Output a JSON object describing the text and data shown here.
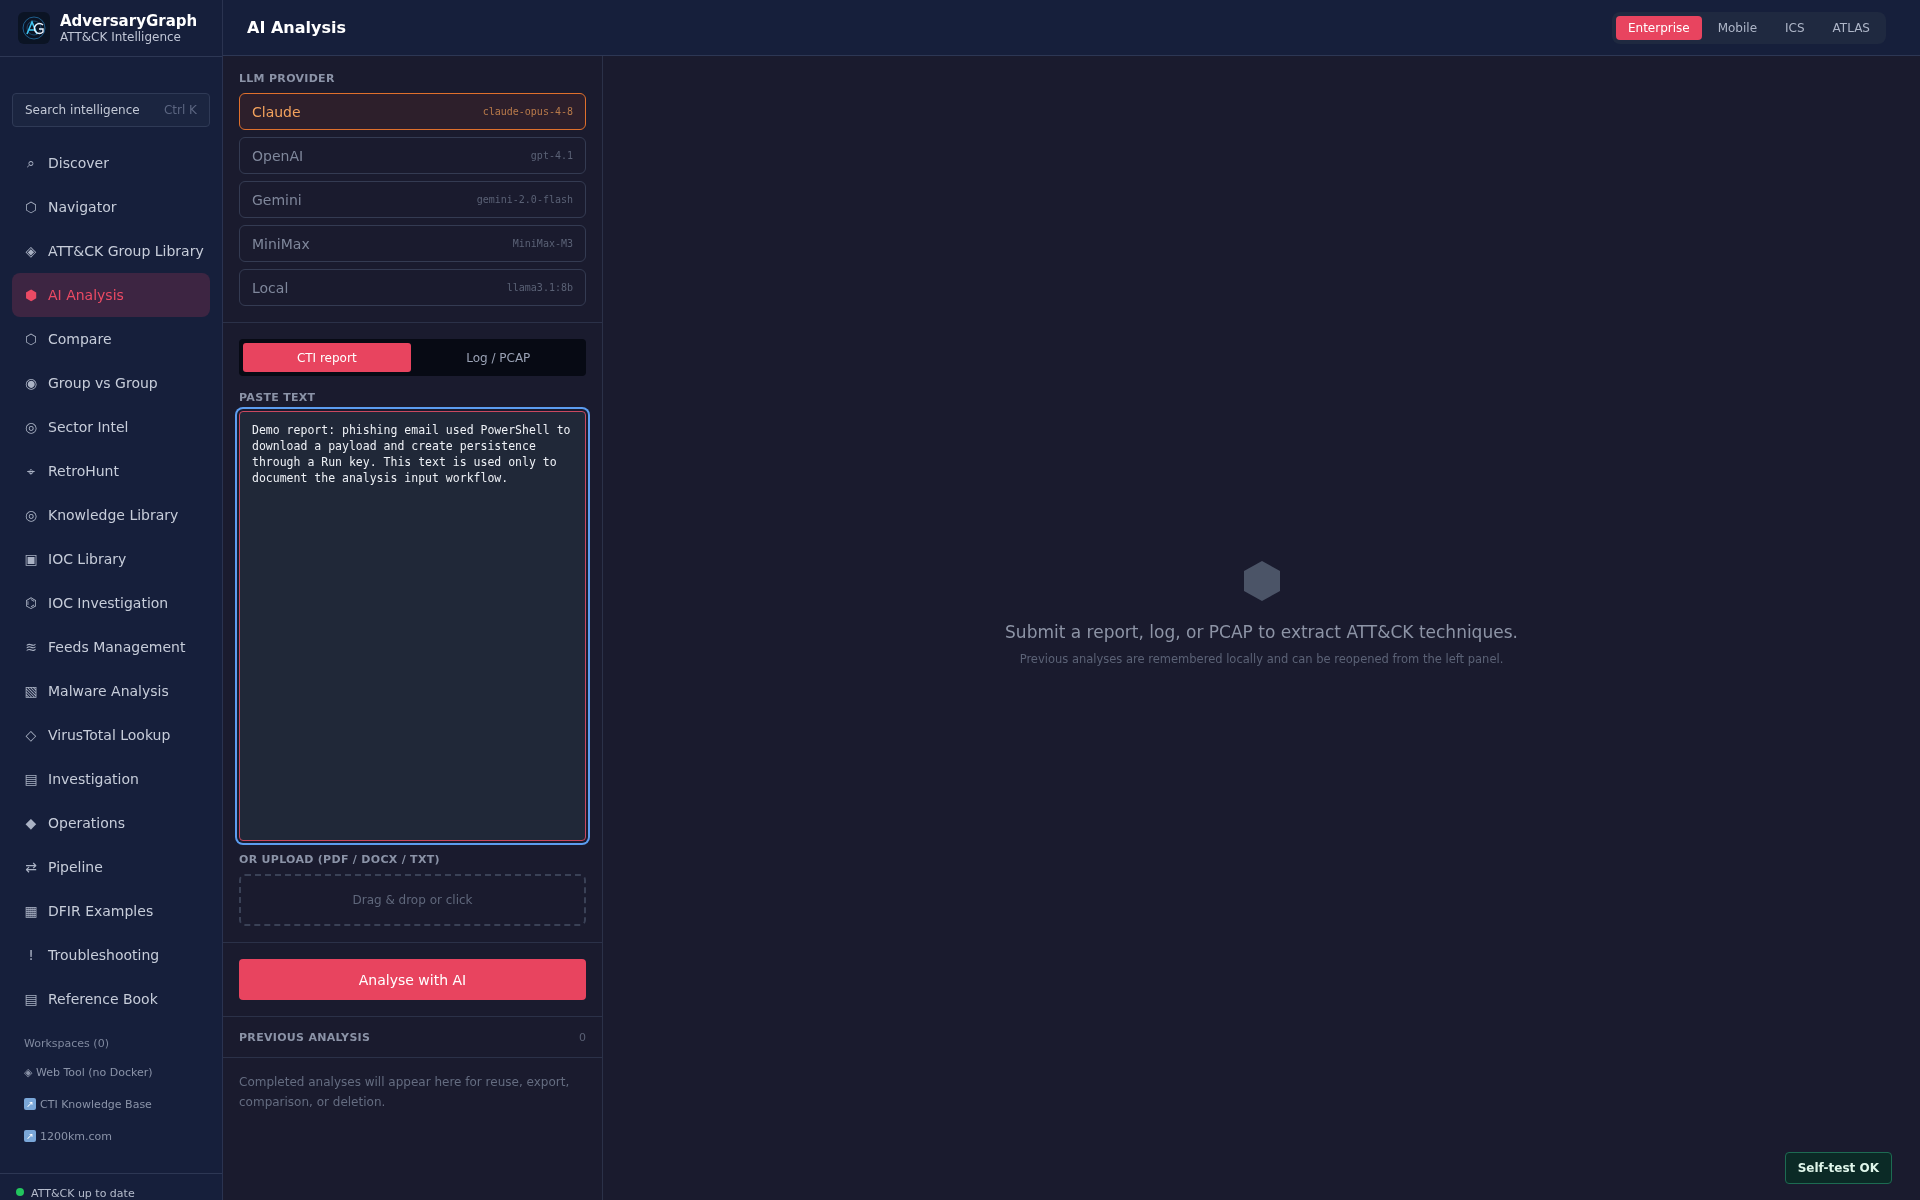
{
  "brand": {
    "name": "AdversaryGraph",
    "tagline": "ATT&CK Intelligence"
  },
  "search": {
    "placeholder": "Search intelligence",
    "shortcut": "Ctrl K"
  },
  "nav": {
    "items": [
      {
        "icon": "⌕",
        "label": "Discover",
        "selected": false
      },
      {
        "icon": "⬡",
        "label": "Navigator",
        "selected": false
      },
      {
        "icon": "◈",
        "label": "ATT&CK Group Library",
        "selected": false
      },
      {
        "icon": "⬢",
        "label": "AI Analysis",
        "selected": true
      },
      {
        "icon": "⬡",
        "label": "Compare",
        "selected": false
      },
      {
        "icon": "◉",
        "label": "Group vs Group",
        "selected": false
      },
      {
        "icon": "◎",
        "label": "Sector Intel",
        "selected": false
      },
      {
        "icon": "⌖",
        "label": "RetroHunt",
        "selected": false
      },
      {
        "icon": "◎",
        "label": "Knowledge Library",
        "selected": false
      },
      {
        "icon": "▣",
        "label": "IOC Library",
        "selected": false
      },
      {
        "icon": "⌬",
        "label": "IOC Investigation",
        "selected": false
      },
      {
        "icon": "≋",
        "label": "Feeds Management",
        "selected": false
      },
      {
        "icon": "▧",
        "label": "Malware Analysis",
        "selected": false
      },
      {
        "icon": "◇",
        "label": "VirusTotal Lookup",
        "selected": false
      },
      {
        "icon": "▤",
        "label": "Investigation",
        "selected": false
      },
      {
        "icon": "◆",
        "label": "Operations",
        "selected": false
      },
      {
        "icon": "⇄",
        "label": "Pipeline",
        "selected": false
      },
      {
        "icon": "▦",
        "label": "DFIR Examples",
        "selected": false
      },
      {
        "icon": "!",
        "label": "Troubleshooting",
        "selected": false
      },
      {
        "icon": "▤",
        "label": "Reference Book",
        "selected": false
      }
    ]
  },
  "workspaces": "Workspaces (0)",
  "links": [
    {
      "kind": "tool",
      "label": "◈ Web Tool (no Docker)"
    },
    {
      "kind": "external",
      "icon": "↗",
      "label": "CTI Knowledge Base"
    },
    {
      "kind": "external",
      "icon": "↗",
      "label": "1200km.com"
    }
  ],
  "status": {
    "ok": true,
    "text": "ATT&CK up to date"
  },
  "header": {
    "title": "AI Analysis"
  },
  "frameworks": [
    {
      "label": "Enterprise",
      "selected": true
    },
    {
      "label": "Mobile",
      "selected": false
    },
    {
      "label": "ICS",
      "selected": false
    },
    {
      "label": "ATLAS",
      "selected": false
    }
  ],
  "provider_label": "LLM PROVIDER",
  "providers": [
    {
      "name": "Claude",
      "model": "claude-opus-4-8",
      "selected": true
    },
    {
      "name": "OpenAI",
      "model": "gpt-4.1",
      "selected": false
    },
    {
      "name": "Gemini",
      "model": "gemini-2.0-flash",
      "selected": false
    },
    {
      "name": "MiniMax",
      "model": "MiniMax-M3",
      "selected": false
    },
    {
      "name": "Local",
      "model": "llama3.1:8b",
      "selected": false
    }
  ],
  "modes": [
    {
      "label": "CTI report",
      "selected": true
    },
    {
      "label": "Log / PCAP",
      "selected": false
    }
  ],
  "paste": {
    "label": "PASTE TEXT",
    "value": "Demo report: phishing email used PowerShell to download a payload and create persistence through a Run key. This text is used only to document the analysis input workflow.",
    "focused": true
  },
  "upload": {
    "label": "OR UPLOAD (PDF / DOCX / TXT)",
    "hint": "Drag & drop or click"
  },
  "analyse_button": "Analyse with AI",
  "previous": {
    "title": "PREVIOUS ANALYSIS",
    "count": "0",
    "empty": "Completed analyses will appear here for reuse, export, comparison, or deletion."
  },
  "empty_state": {
    "title": "Submit a report, log, or PCAP to extract ATT&CK techniques.",
    "subtitle": "Previous analyses are remembered locally and can be reopened from the left panel."
  },
  "toast": "Self-test OK"
}
